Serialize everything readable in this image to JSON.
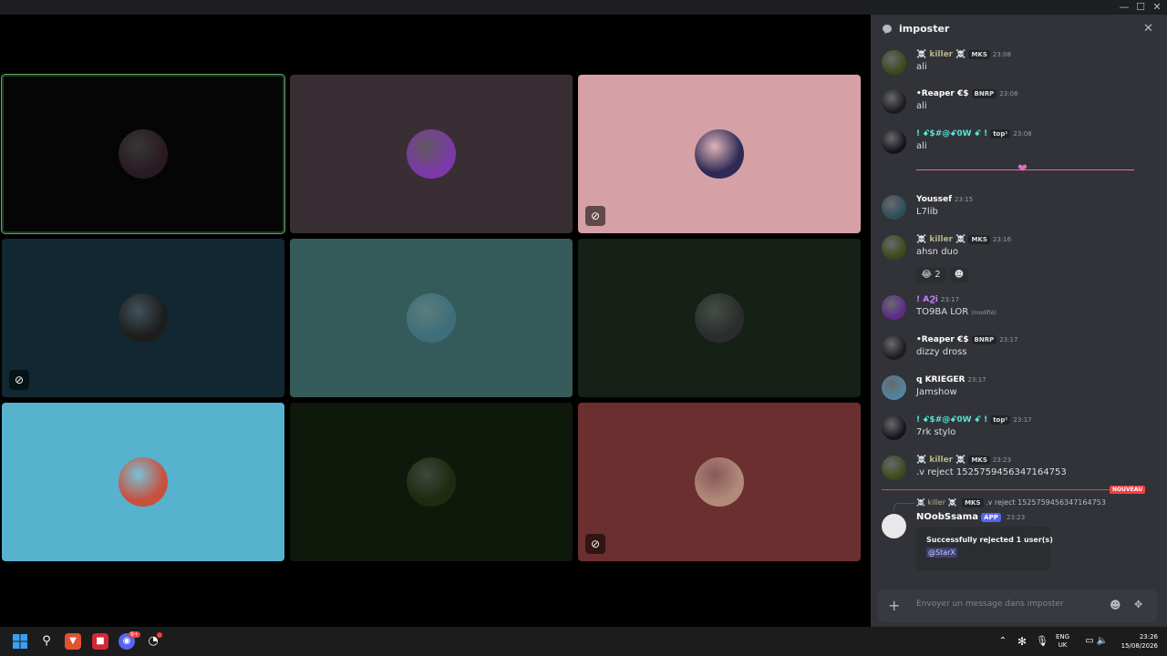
{
  "window": {
    "minimize": "—",
    "maximize": "☐",
    "close": "✕"
  },
  "call": {
    "tiles": [
      {
        "bg": "#050505",
        "speaking": true,
        "muted": false,
        "avatar_color": "#2a1a22"
      },
      {
        "bg": "#3a2e35",
        "speaking": false,
        "muted": false,
        "avatar_color": "#7b3aa8"
      },
      {
        "bg": "#d6a1a6",
        "speaking": false,
        "muted": true,
        "avatar_color": "#2e2a55"
      },
      {
        "bg": "#112833",
        "speaking": false,
        "muted": true,
        "avatar_color": "#1d1d1d"
      },
      {
        "bg": "#345b59",
        "speaking": false,
        "muted": false,
        "avatar_color": "#3d6f7b"
      },
      {
        "bg": "#162016",
        "speaking": false,
        "muted": false,
        "avatar_color": "#2a2d2c"
      },
      {
        "bg": "#56b2cd",
        "speaking": false,
        "muted": false,
        "avatar_color": "#c8503d"
      },
      {
        "bg": "#0e190b",
        "speaking": false,
        "muted": false,
        "avatar_color": "#1f2a0e"
      },
      {
        "bg": "#6c2f2f",
        "speaking": false,
        "muted": true,
        "avatar_color": "#b08a7a"
      }
    ],
    "mute_icon": "mic-off-icon"
  },
  "chat": {
    "title": "imposter",
    "close_label": "✕",
    "messages": [
      {
        "name": "☠️ killer ☠️",
        "name_color": "#b7b48a",
        "badge": "MKS",
        "time": "23:08",
        "text": "ali",
        "avatar_color": "#3a4a18",
        "edited": ""
      },
      {
        "name": "•Reaper €$",
        "name_color": "#ffffff",
        "badge": "BNRP",
        "time": "23:08",
        "text": "ali",
        "avatar_color": "#1b1b1b",
        "edited": ""
      },
      {
        "name": "! ꗃ$#@ꗃ0W ꗃ !",
        "name_color": "#53e3d6",
        "badge": "top¹",
        "time": "23:08",
        "text": "ali",
        "avatar_color": "#15121a",
        "edited": ""
      },
      {
        "name": "Youssef",
        "name_color": "#ffffff",
        "badge": "",
        "time": "23:15",
        "text": "L7lib",
        "avatar_color": "#2c4e58",
        "edited": ""
      },
      {
        "name": "☠️ killer ☠️",
        "name_color": "#b7b48a",
        "badge": "MKS",
        "time": "23:16",
        "text": "ahsn duo",
        "avatar_color": "#3a4a18",
        "edited": ""
      },
      {
        "name": "! AϨi",
        "name_color": "#c681ff",
        "badge": "",
        "time": "23:17",
        "text": "TO9BA LOR",
        "avatar_color": "#5c2a8a",
        "edited": "(modifié)"
      },
      {
        "name": "•Reaper €$",
        "name_color": "#ffffff",
        "badge": "BNRP",
        "time": "23:17",
        "text": "dizzy dross",
        "avatar_color": "#1b1b1b",
        "edited": ""
      },
      {
        "name": "ꝗ KRIEGER",
        "name_color": "#ffffff",
        "badge": "",
        "time": "23:17",
        "text": "Jamshow",
        "avatar_color": "#4f86a3",
        "edited": ""
      },
      {
        "name": "! ꗃ$#@ꗃ0W ꗃ !",
        "name_color": "#53e3d6",
        "badge": "top¹",
        "time": "23:17",
        "text": "7rk stylo",
        "avatar_color": "#15121a",
        "edited": ""
      },
      {
        "name": "☠️ killer ☠️",
        "name_color": "#b7b48a",
        "badge": "MKS",
        "time": "23:23",
        "text": ".v reject 1525759456347164753",
        "avatar_color": "#3a4a18",
        "edited": ""
      }
    ],
    "reactions": [
      {
        "emoji": "😂",
        "count": "2"
      },
      {
        "emoji": "☻",
        "count": ""
      }
    ],
    "new_label": "NOUVEAU",
    "reply": {
      "name": "☠️ killer ☠️",
      "badge": "MKS",
      "text": ".v reject 1525759456347164753"
    },
    "bot": {
      "name": "NOobSsama",
      "badge": "APP",
      "time": "23:23",
      "embed_title": "Successfully rejected 1 user(s)",
      "embed_mention": "@StarX"
    },
    "placeholder": "Envoyer un message dans imposter"
  },
  "taskbar": {
    "lang_top": "ENG",
    "lang_bottom": "UK",
    "clock_time": "23:26",
    "clock_date": "15/08/2026",
    "discord_badge": "9+"
  }
}
